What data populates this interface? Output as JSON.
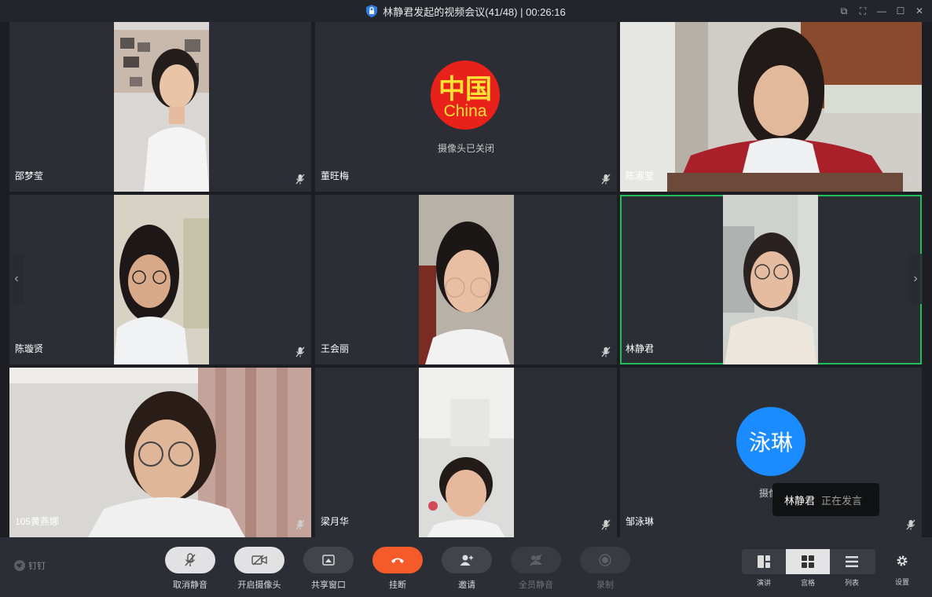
{
  "window": {
    "title": "林静君发起的视频会议(41/48) | 00:26:16",
    "controls": [
      "⧉",
      "⛶",
      "—",
      "☐",
      "✕"
    ]
  },
  "participants": [
    {
      "name": "邵梦莹",
      "camera": "on",
      "muted": true
    },
    {
      "name": "董旺梅",
      "camera": "off",
      "muted": true,
      "avatar_text_top": "中国",
      "avatar_text_bottom": "China",
      "status": "摄像头已关闭"
    },
    {
      "name": "陈淑莹",
      "camera": "on",
      "muted": true
    },
    {
      "name": "陈璇贤",
      "camera": "on",
      "muted": true
    },
    {
      "name": "王会丽",
      "camera": "on",
      "muted": true
    },
    {
      "name": "林静君",
      "camera": "on",
      "muted": false,
      "speaking": true
    },
    {
      "name": "105黄燕娜",
      "camera": "on",
      "muted": true
    },
    {
      "name": "梁月华",
      "camera": "on",
      "muted": true
    },
    {
      "name": "邹泳琳",
      "camera": "off",
      "muted": true,
      "avatar_text": "泳琳",
      "status": "摄像头"
    }
  ],
  "speaking_tooltip": {
    "name": "林静君",
    "label": "正在发言"
  },
  "toolbar": {
    "brand": "钉钉",
    "buttons": [
      {
        "label": "取消静音",
        "icon": "mic-muted-icon"
      },
      {
        "label": "开启摄像头",
        "icon": "camera-off-icon"
      },
      {
        "label": "共享窗口",
        "icon": "share-window-icon"
      },
      {
        "label": "挂断",
        "icon": "hang-up-icon"
      },
      {
        "label": "邀请",
        "icon": "invite-icon"
      },
      {
        "label": "全员静音",
        "icon": "mute-all-icon",
        "enabled": false
      },
      {
        "label": "录制",
        "icon": "record-icon",
        "enabled": false
      }
    ],
    "layouts": [
      {
        "label": "演讲",
        "icon": "speaker-layout-icon"
      },
      {
        "label": "宫格",
        "icon": "grid-layout-icon",
        "selected": true
      },
      {
        "label": "列表",
        "icon": "list-layout-icon"
      }
    ],
    "settings_label": "设置"
  },
  "colors": {
    "active_border": "#1fbf5a",
    "hangup": "#f45a2a",
    "avatar_blue": "#1a8cff",
    "avatar_red": "#e8221b"
  }
}
